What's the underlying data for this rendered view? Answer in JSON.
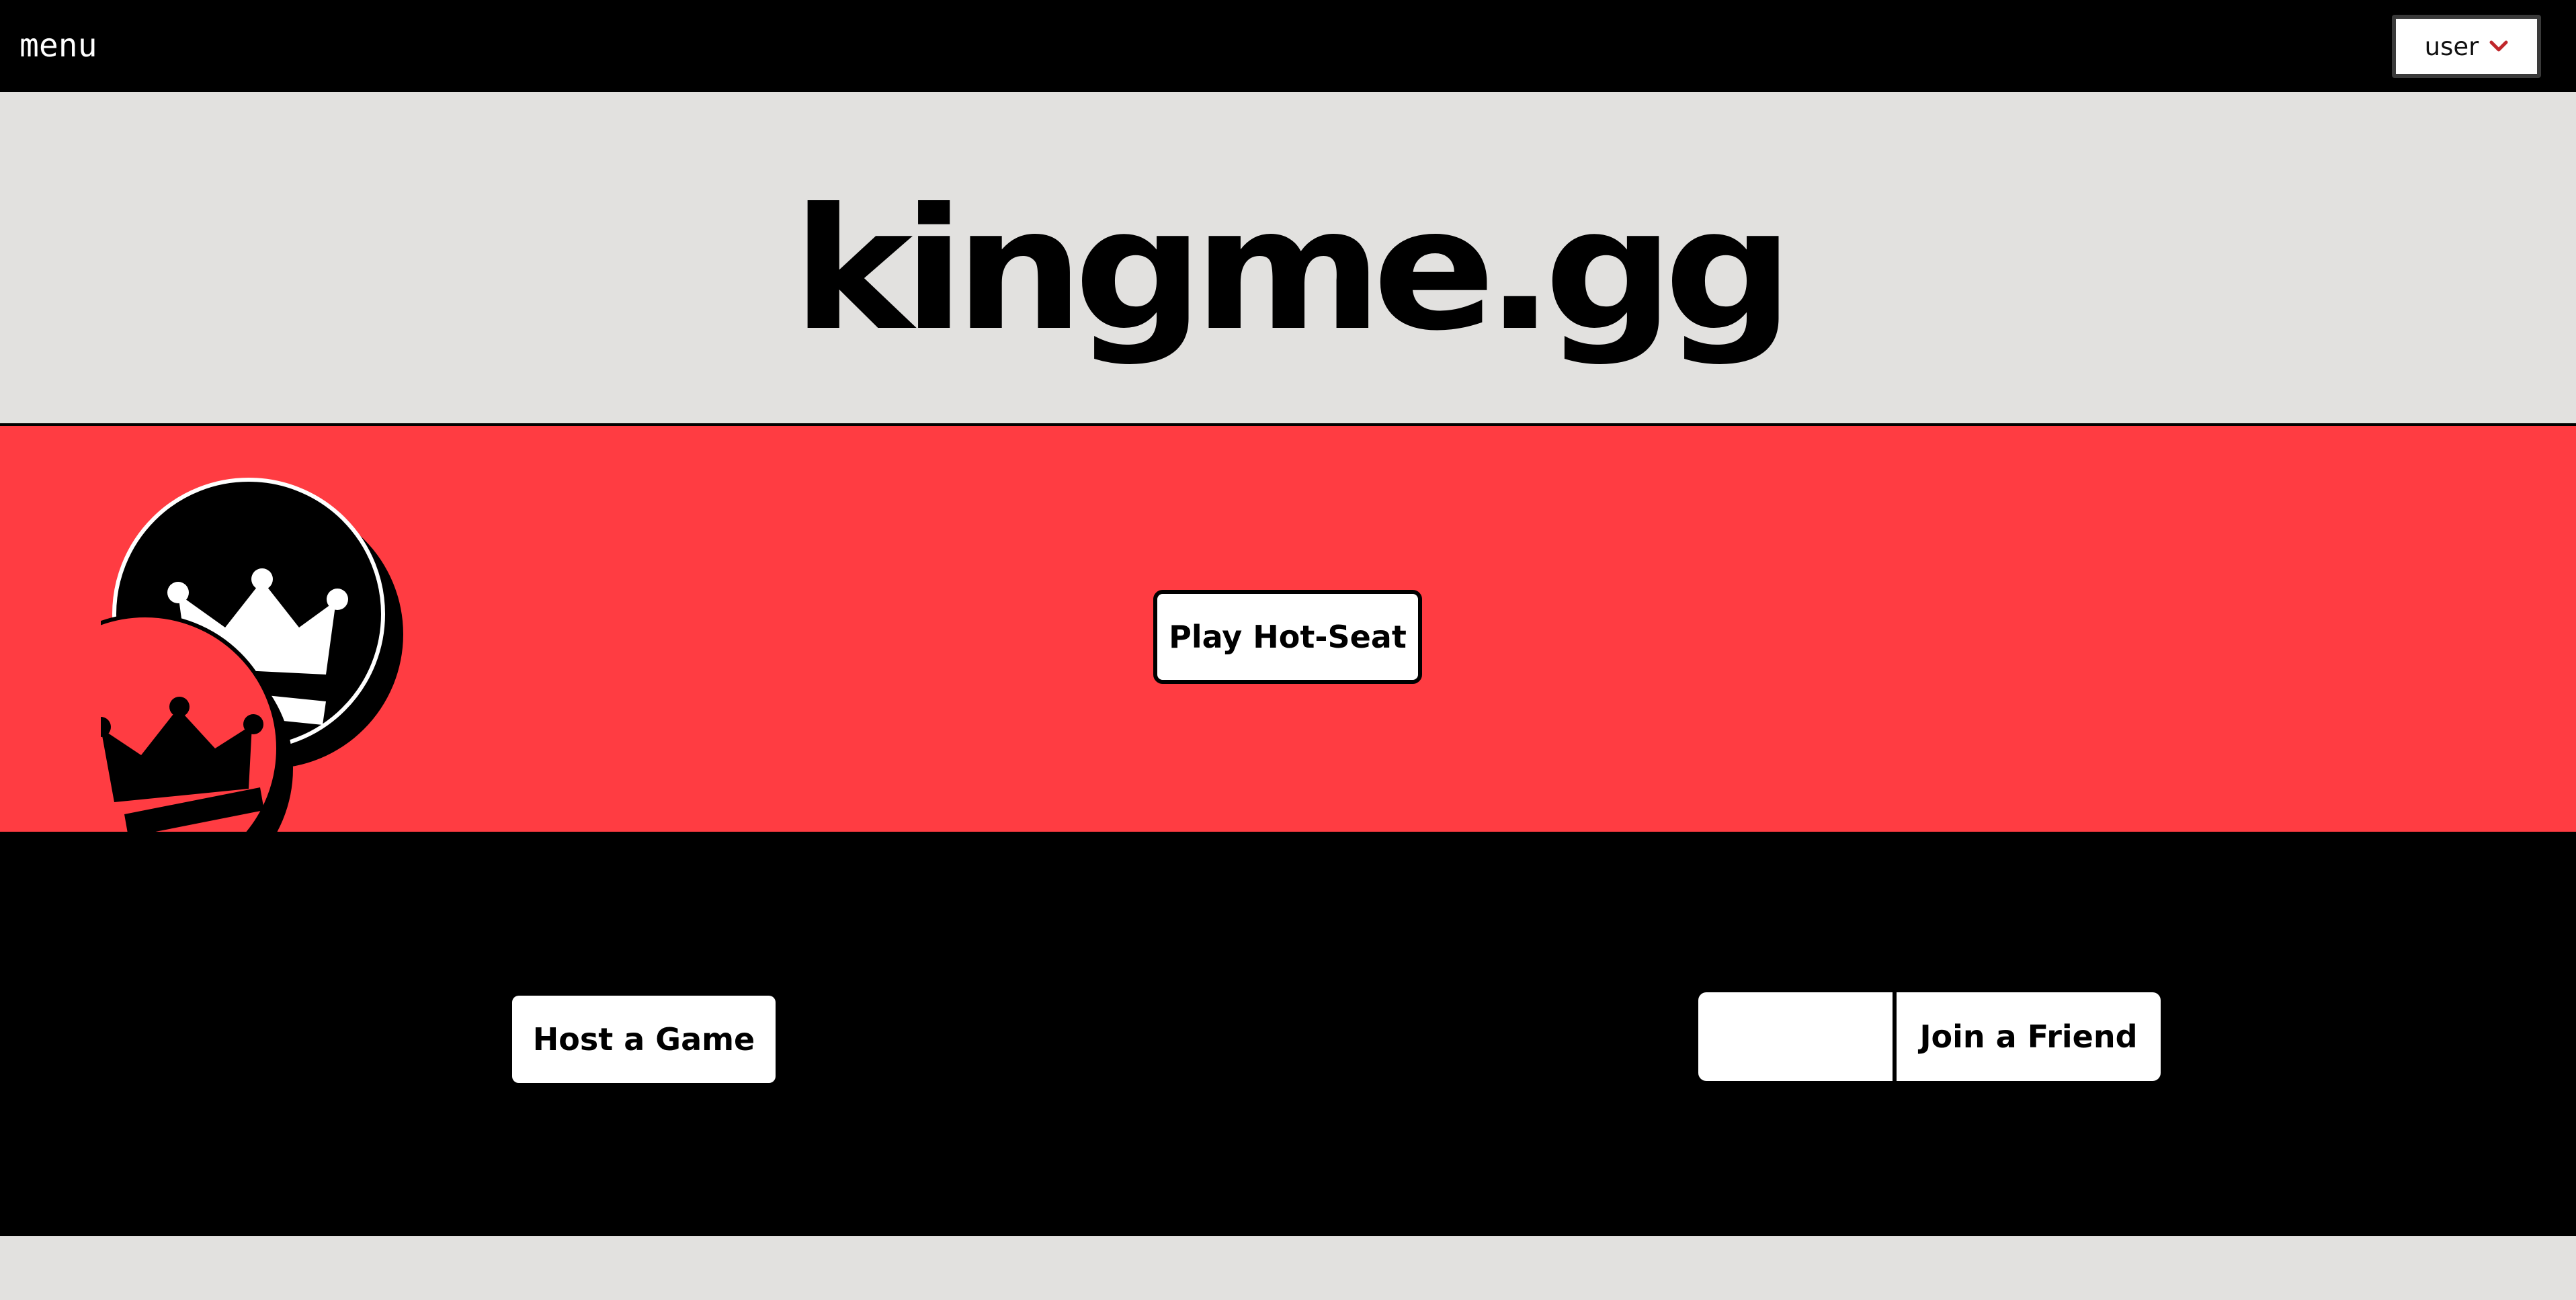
{
  "topbar": {
    "menu_label": "menu",
    "user_label": "user",
    "chevron_icon": "chevron-down-icon",
    "chevron_color": "#c0262b"
  },
  "logo": {
    "text": "kingme.gg"
  },
  "hero": {
    "hotseat_label": "Play Hot-Seat",
    "art_icon": "checker-kings-icon",
    "background_color": "#ff3c42"
  },
  "multiplayer": {
    "host_label": "Host a Game",
    "join_input_value": "",
    "join_input_placeholder": "",
    "join_label": "Join a Friend"
  }
}
